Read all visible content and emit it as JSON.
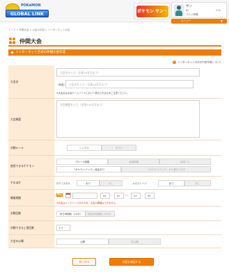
{
  "header": {
    "logo_main": "POKéMON",
    "logo_sub": "GLOBAL LINK",
    "game_title": "ポケモン サン・ムーン",
    "user": {
      "name": "サン",
      "row1_label": "ID",
      "row2_label": "プレイ時間",
      "percent": "0 %"
    },
    "menu_label": "メニュー",
    "menu_caret": "▼"
  },
  "breadcrumb": [
    "トップ",
    "仲間大会",
    "大会の作成",
    "インターネット大会"
  ],
  "breadcrumb_sep": ">",
  "page": {
    "title": "仲間大会",
    "section_title": "インターネット方式の仲間大会作成",
    "help_link": "インターネット方式の大会作成について",
    "help_icon": "?"
  },
  "form": {
    "tournament_name": {
      "label": "大会名",
      "placeholder_main": "大会名を入力（全角16文字まで）",
      "placeholder_sub_label": "（英語）",
      "placeholder_sub": "大会名を入力（全角16文字まで）",
      "note": "※大会名は大会ゲームソフトにおいて表示されるためご注意ください。"
    },
    "overview": {
      "label": "大会概要",
      "placeholder": "大会概要を入力（全角200文字まで）"
    },
    "battle_rule": {
      "label": "対戦ルール",
      "options": [
        "シングル",
        "ダブル"
      ]
    },
    "usable_pokemon": {
      "label": "使用できるポケモン",
      "row1": [
        "アローラ図鑑",
        "全国図鑑",
        "全国フル"
      ],
      "row2": [
        "「ポケモンバンク」経由あり",
        "「ポケモンバンク」から連れてきた"
      ]
    },
    "other": {
      "label": "そのほか",
      "items": [
        {
          "text": "Zクリスタル",
          "on": "あり",
          "off": "なし"
        },
        {
          "text": "メガストーン",
          "on": "あり",
          "off": "なし"
        }
      ]
    },
    "period": {
      "label": "開催期間",
      "start_label": "開始",
      "date_value": "",
      "hour": "00",
      "minute_sep": ":",
      "min": "00",
      "tilde": "〜",
      "end_hour": "23",
      "end_min": "59",
      "note": "※大会はメンテナンス日のため、大会の開催はできません。"
    },
    "rounds": {
      "label": "対戦回数",
      "options": [
        "持ち時間制（10分）",
        "総試合時間制（60分）"
      ]
    },
    "entries": {
      "label": "対戦できる上限回数",
      "value": "3"
    },
    "public": {
      "label": "大会の公開",
      "options": [
        "公開",
        "非公開"
      ]
    }
  },
  "buttons": {
    "back": "前に戻る",
    "confirm": "内容を確認する"
  },
  "colors": {
    "accent": "#f07d00",
    "label_bg": "#fdebd6"
  }
}
